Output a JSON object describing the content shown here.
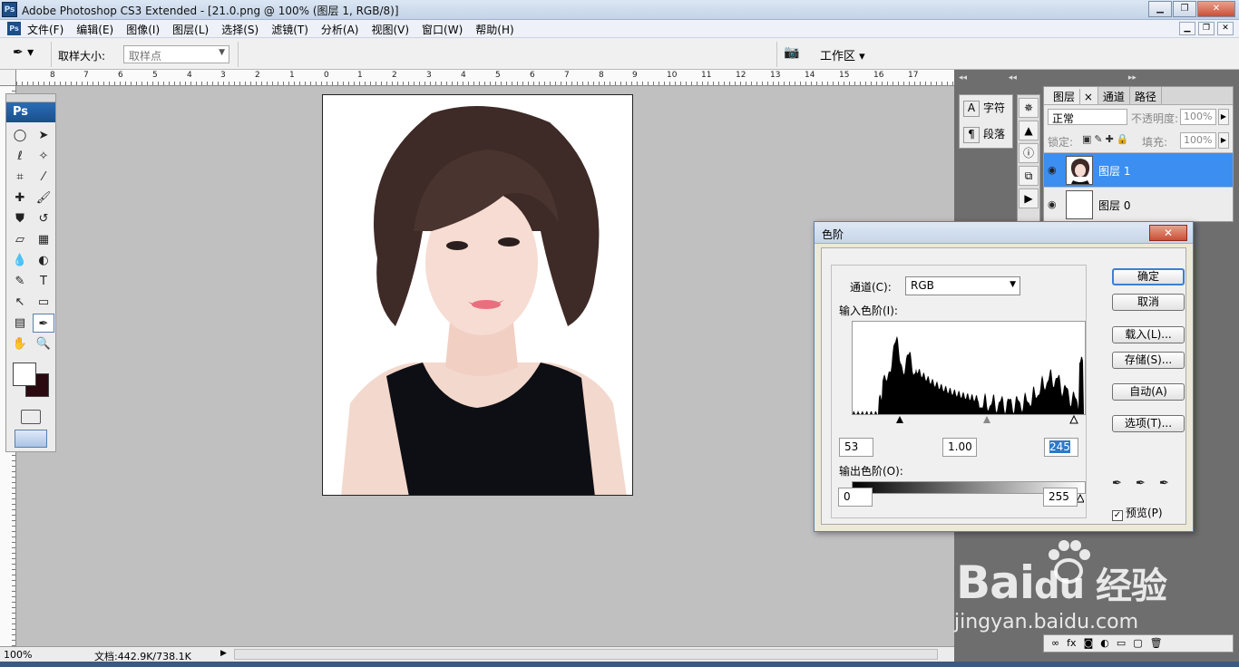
{
  "window": {
    "title": "Adobe Photoshop CS3 Extended - [21.0.png @ 100% (图层 1, RGB/8)]",
    "app_icon_text": "Ps"
  },
  "menu": {
    "items": [
      "文件(F)",
      "编辑(E)",
      "图像(I)",
      "图层(L)",
      "选择(S)",
      "滤镜(T)",
      "分析(A)",
      "视图(V)",
      "窗口(W)",
      "帮助(H)"
    ]
  },
  "options": {
    "sample_size_label": "取样大小:",
    "sample_size_value": "取样点",
    "workspace_label": "工作区"
  },
  "ruler": {
    "top_labels": [
      "8",
      "7",
      "6",
      "5",
      "4",
      "3",
      "2",
      "1",
      "0",
      "1",
      "2",
      "3",
      "4",
      "5",
      "6",
      "7",
      "8",
      "9",
      "10",
      "11",
      "12",
      "13",
      "14",
      "15",
      "16",
      "17"
    ]
  },
  "toolbox": {
    "logo": "Ps",
    "fg_color": "#ffffff",
    "bg_color": "#2a0a10"
  },
  "status": {
    "zoom": "100%",
    "doc_size": "文档:442.9K/738.1K"
  },
  "char_panel": {
    "char_label": "字符",
    "para_label": "段落"
  },
  "layers_panel": {
    "tabs": [
      "图层",
      "通道",
      "路径"
    ],
    "blend_mode": "正常",
    "opacity_label": "不透明度:",
    "opacity_value": "100%",
    "lock_label": "锁定:",
    "fill_label": "填充:",
    "fill_value": "100%",
    "layers": [
      {
        "name": "图层 1",
        "selected": true
      },
      {
        "name": "图层 0",
        "selected": false
      }
    ]
  },
  "levels": {
    "title": "色阶",
    "channel_label": "通道(C):",
    "channel_value": "RGB",
    "input_label": "输入色阶(I):",
    "input_black": "53",
    "input_gamma": "1.00",
    "input_white": "245",
    "output_label": "输出色阶(O):",
    "output_black": "0",
    "output_white": "255",
    "buttons": {
      "ok": "确定",
      "cancel": "取消",
      "load": "载入(L)...",
      "save": "存储(S)...",
      "auto": "自动(A)",
      "options": "选项(T)..."
    },
    "preview_label": "预览(P)",
    "preview_checked": true
  },
  "watermark": {
    "brand": "Bai",
    "brand_suffix": "du 经验",
    "url": "jingyan.baidu.com"
  }
}
